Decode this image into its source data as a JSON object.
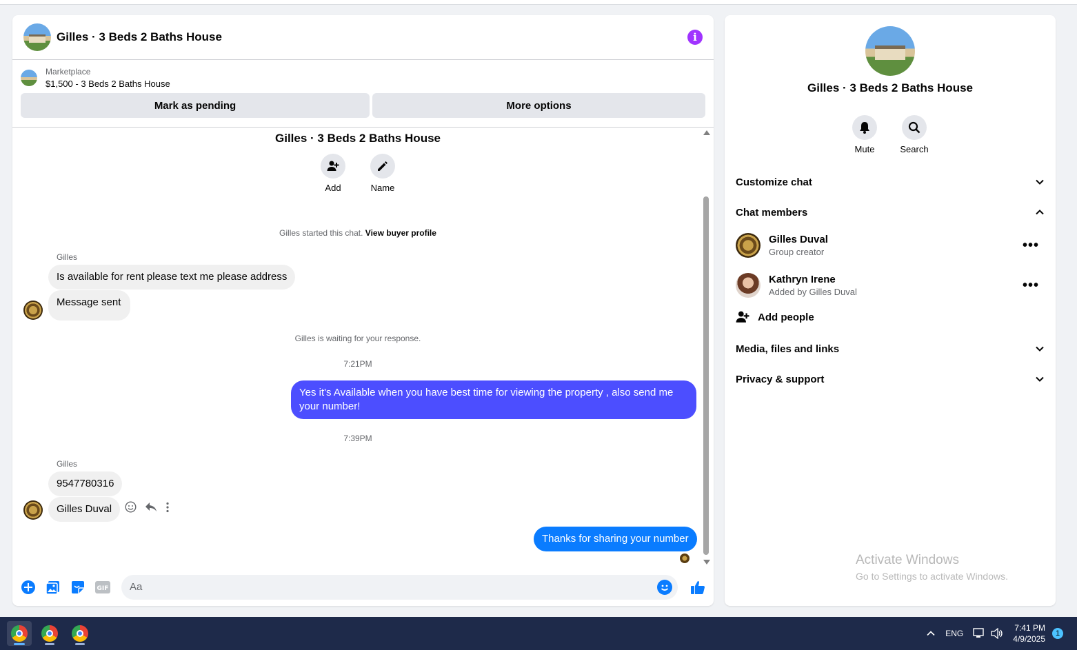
{
  "chat": {
    "title": "Gilles · 3 Beds 2 Baths House",
    "marketplace_label": "Marketplace",
    "listing": "$1,500 - 3 Beds 2 Baths House",
    "mark_pending_label": "Mark as pending",
    "more_options_label": "More options",
    "conversation_title": "Gilles · 3 Beds 2 Baths House",
    "add_label": "Add",
    "name_label": "Name",
    "started_text": "Gilles started this chat.",
    "view_buyer_profile": "View buyer profile",
    "messages": [
      {
        "sender": "Gilles",
        "text": "Is available for rent please text me please address"
      },
      {
        "text": "Message sent"
      },
      {
        "system": "Gilles is waiting for your response."
      },
      {
        "time": "7:21PM"
      },
      {
        "outgoing": true,
        "text": "Yes it's Available when you have best time for viewing the property , also send me your number!"
      },
      {
        "time": "7:39PM"
      },
      {
        "sender": "Gilles",
        "text": "9547780316"
      },
      {
        "text": "Gilles Duval"
      },
      {
        "outgoing": true,
        "text": "Thanks for sharing your number"
      }
    ],
    "composer_placeholder": "Aa"
  },
  "side": {
    "title": "Gilles · 3 Beds 2 Baths House",
    "mute_label": "Mute",
    "search_label": "Search",
    "sections": {
      "customize": "Customize chat",
      "members": "Chat members",
      "media": "Media, files and links",
      "privacy": "Privacy & support"
    },
    "members": [
      {
        "name": "Gilles Duval",
        "sub": "Group creator"
      },
      {
        "name": "Kathryn Irene",
        "sub": "Added by Gilles Duval"
      }
    ],
    "add_people_label": "Add people",
    "watermark_title": "Activate Windows",
    "watermark_sub": "Go to Settings to activate Windows."
  },
  "taskbar": {
    "lang": "ENG",
    "time": "7:41 PM",
    "date": "4/9/2025",
    "notifications": "1"
  },
  "colors": {
    "outgoing_bubble": "#4c4eff",
    "outgoing_bubble_latest": "#0a7cff",
    "accent": "#0a7cff",
    "info": "#a033ff"
  }
}
